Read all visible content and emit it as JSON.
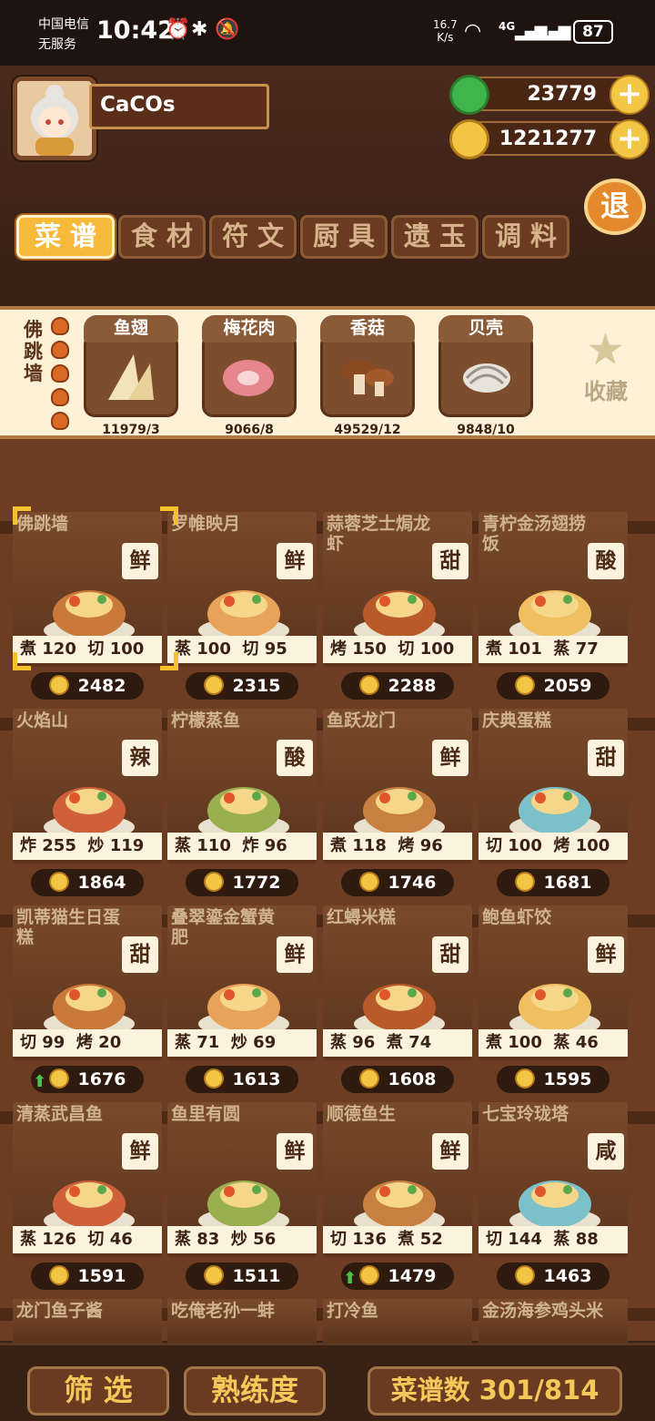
{
  "status_bar": {
    "carrier_line1": "中国电信",
    "carrier_line2": "无服务",
    "time": "10:42",
    "net_speed_value": "16.7",
    "net_speed_unit": "K/s",
    "network_type": "4G",
    "battery": "87",
    "icons": [
      "alarm-icon",
      "bluetooth-icon",
      "mute-icon",
      "wifi-icon",
      "signal-icon",
      "battery-icon"
    ]
  },
  "player": {
    "name": "CaCOs",
    "jade": "23779",
    "gold": "1221277",
    "exit_label": "退"
  },
  "tabs": [
    {
      "label": "菜谱",
      "active": true
    },
    {
      "label": "食材",
      "active": false
    },
    {
      "label": "符文",
      "active": false
    },
    {
      "label": "厨具",
      "active": false
    },
    {
      "label": "遗玉",
      "active": false
    },
    {
      "label": "调料",
      "active": false
    }
  ],
  "selected_dish": {
    "name": "佛跳墙",
    "ingredients": [
      {
        "name": "鱼翅",
        "count": "11979/3"
      },
      {
        "name": "梅花肉",
        "count": "9066/8"
      },
      {
        "name": "香菇",
        "count": "49529/12"
      },
      {
        "name": "贝壳",
        "count": "9848/10"
      }
    ],
    "favorite_label": "收藏"
  },
  "recipes": [
    {
      "name": "佛跳墙",
      "flavor": "鲜",
      "skill1": "煮",
      "val1": "120",
      "skill2": "切",
      "val2": "100",
      "price": "2482",
      "up": false
    },
    {
      "name": "罗帷映月",
      "flavor": "鲜",
      "skill1": "蒸",
      "val1": "100",
      "skill2": "切",
      "val2": "95",
      "price": "2315",
      "up": false
    },
    {
      "name": "蒜蓉芝士焗龙虾",
      "flavor": "甜",
      "skill1": "烤",
      "val1": "150",
      "skill2": "切",
      "val2": "100",
      "price": "2288",
      "up": false
    },
    {
      "name": "青柠金汤翅捞饭",
      "flavor": "酸",
      "skill1": "煮",
      "val1": "101",
      "skill2": "蒸",
      "val2": "77",
      "price": "2059",
      "up": false
    },
    {
      "name": "火焰山",
      "flavor": "辣",
      "skill1": "炸",
      "val1": "255",
      "skill2": "炒",
      "val2": "119",
      "price": "1864",
      "up": false
    },
    {
      "name": "柠檬蒸鱼",
      "flavor": "酸",
      "skill1": "蒸",
      "val1": "110",
      "skill2": "炸",
      "val2": "96",
      "price": "1772",
      "up": false
    },
    {
      "name": "鱼跃龙门",
      "flavor": "鲜",
      "skill1": "煮",
      "val1": "118",
      "skill2": "烤",
      "val2": "96",
      "price": "1746",
      "up": false
    },
    {
      "name": "庆典蛋糕",
      "flavor": "甜",
      "skill1": "切",
      "val1": "100",
      "skill2": "烤",
      "val2": "100",
      "price": "1681",
      "up": false
    },
    {
      "name": "凯蒂猫生日蛋糕",
      "flavor": "甜",
      "skill1": "切",
      "val1": "99",
      "skill2": "烤",
      "val2": "20",
      "price": "1676",
      "up": true
    },
    {
      "name": "叠翠鎏金蟹黄肥",
      "flavor": "鲜",
      "skill1": "蒸",
      "val1": "71",
      "skill2": "炒",
      "val2": "69",
      "price": "1613",
      "up": false
    },
    {
      "name": "红蟳米糕",
      "flavor": "甜",
      "skill1": "蒸",
      "val1": "96",
      "skill2": "煮",
      "val2": "74",
      "price": "1608",
      "up": false
    },
    {
      "name": "鲍鱼虾饺",
      "flavor": "鲜",
      "skill1": "煮",
      "val1": "100",
      "skill2": "蒸",
      "val2": "46",
      "price": "1595",
      "up": false
    },
    {
      "name": "清蒸武昌鱼",
      "flavor": "鲜",
      "skill1": "蒸",
      "val1": "126",
      "skill2": "切",
      "val2": "46",
      "price": "1591",
      "up": false
    },
    {
      "name": "鱼里有圆",
      "flavor": "鲜",
      "skill1": "蒸",
      "val1": "83",
      "skill2": "炒",
      "val2": "56",
      "price": "1511",
      "up": false
    },
    {
      "name": "顺德鱼生",
      "flavor": "鲜",
      "skill1": "切",
      "val1": "136",
      "skill2": "煮",
      "val2": "52",
      "price": "1479",
      "up": true
    },
    {
      "name": "七宝玲珑塔",
      "flavor": "咸",
      "skill1": "切",
      "val1": "144",
      "skill2": "蒸",
      "val2": "88",
      "price": "1463",
      "up": false
    }
  ],
  "partial_recipes": [
    "龙门鱼子酱",
    "吃俺老孙一蚌",
    "打冷鱼",
    "金汤海参鸡头米"
  ],
  "bottom_bar": {
    "filter_label": "筛 选",
    "proficiency_label": "熟练度",
    "recipe_count_label": "菜谱数 301/814"
  }
}
